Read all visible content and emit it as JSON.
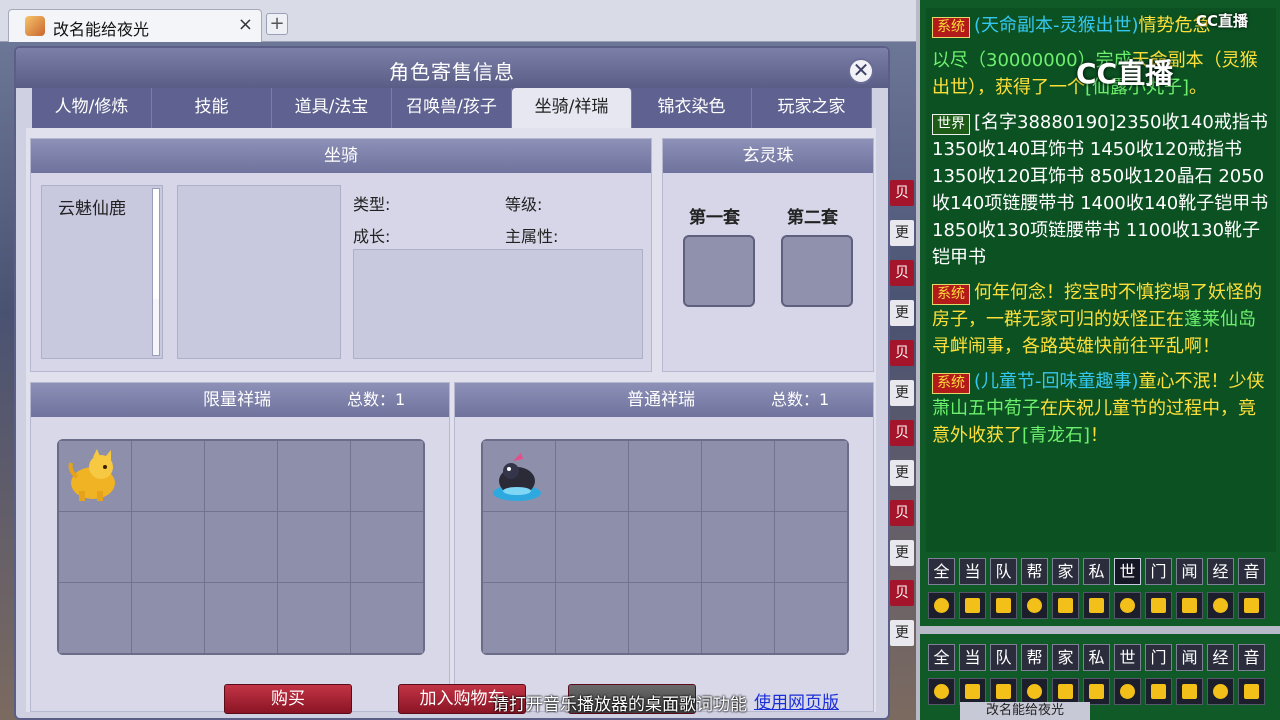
{
  "window": {
    "tab_title": "改名能给夜光",
    "close_glyph": "×",
    "new_tab_glyph": "+"
  },
  "panel": {
    "title": "角色寄售信息",
    "close_glyph": "✕",
    "tabs": [
      "人物/修炼",
      "技能",
      "道具/法宝",
      "召唤兽/孩子",
      "坐骑/祥瑞",
      "锦衣染色",
      "玩家之家"
    ],
    "active_tab": "坐骑/祥瑞"
  },
  "mount": {
    "header": "坐骑",
    "list": [
      "云魅仙鹿"
    ],
    "type_label": "类型:",
    "level_label": "等级:",
    "growth_label": "成长:",
    "main_attr_label": "主属性:"
  },
  "orb": {
    "header": "玄灵珠",
    "set1": "第一套",
    "set2": "第二套"
  },
  "limited": {
    "header": "限量祥瑞",
    "count_label": "总数：",
    "count": "1",
    "item_icon": "golden-tiger-pet-icon"
  },
  "normal": {
    "header": "普通祥瑞",
    "count_label": "总数：",
    "count": "1",
    "item_icon": "black-bird-pet-icon"
  },
  "actions": {
    "buy": "购买",
    "add_cart": "加入购物车",
    "third": "",
    "web_link": "使用网页版"
  },
  "subtitle": "请打开音乐播放器的桌面歌词功能",
  "side_buttons": [
    "贝",
    "更",
    "贝",
    "更",
    "贝",
    "更",
    "贝",
    "更",
    "贝",
    "更",
    "贝",
    "更"
  ],
  "chat": {
    "messages": [
      {
        "tag": "系统",
        "kind": "sys",
        "parts": [
          {
            "text": "(天命副本-灵猴出世)",
            "cls": "c"
          },
          {
            "text": "情势危急",
            "cls": "y"
          }
        ]
      },
      {
        "tag": "",
        "kind": "",
        "parts": [
          {
            "text": "以尽（30000000）完成",
            "cls": "g"
          },
          {
            "text": "天命副本（灵猴出世），获得了一个",
            "cls": "y"
          },
          {
            "text": "[仙露小丸子]",
            "cls": "g"
          },
          {
            "text": "。",
            "cls": "y"
          }
        ]
      },
      {
        "tag": "世界",
        "kind": "world",
        "parts": [
          {
            "text": "[名字38880190]2350收140戒指书 1350收140耳饰书 1450收120戒指书 1350收120耳饰书 850收120晶石 2050收140项链腰带书 1400收140靴子铠甲书 1850收130项链腰带书 1100收130靴子铠甲书",
            "cls": "w"
          }
        ]
      },
      {
        "tag": "系统",
        "kind": "sys",
        "parts": [
          {
            "text": "何年何念！挖宝时不慎挖塌了妖怪的房子，一群无家可归的妖怪正在",
            "cls": "y"
          },
          {
            "text": "蓬莱仙岛",
            "cls": "g"
          },
          {
            "text": "寻衅闹事，各路英雄快前往平乱啊！",
            "cls": "y"
          }
        ]
      },
      {
        "tag": "系统",
        "kind": "sys",
        "parts": [
          {
            "text": "(儿童节-回味童趣事)",
            "cls": "c"
          },
          {
            "text": "童心不泯！少侠",
            "cls": "y"
          },
          {
            "text": "萧山五中荀子",
            "cls": "g"
          },
          {
            "text": "在庆祝儿童节的过程中，竟意外收获了",
            "cls": "y"
          },
          {
            "text": "[青龙石]",
            "cls": "g"
          },
          {
            "text": "！",
            "cls": "y"
          }
        ]
      }
    ],
    "channels": [
      "全",
      "当",
      "队",
      "帮",
      "家",
      "私",
      "世",
      "门",
      "闻",
      "经",
      "音"
    ],
    "active_channel": "世",
    "tools": [
      "left-arrow-icon",
      "up-arrow-icon",
      "down-arrow-icon",
      "search-icon",
      "note-icon",
      "group-icon",
      "lock-icon",
      "brush-icon",
      "folder-icon",
      "chat-bubble-icon",
      "list-icon"
    ],
    "tool_colors": [
      "#f3c01a",
      "#f3c01a",
      "#f3c01a",
      "#f3c01a",
      "#f3c01a",
      "#f3c01a",
      "#f3c01a",
      "#f3c01a",
      "#f3c01a",
      "#f3c01a",
      "#f3c01a"
    ],
    "footer": "改名能给夜光"
  },
  "watermark": {
    "big": "CC直播",
    "small": "CC直播"
  }
}
